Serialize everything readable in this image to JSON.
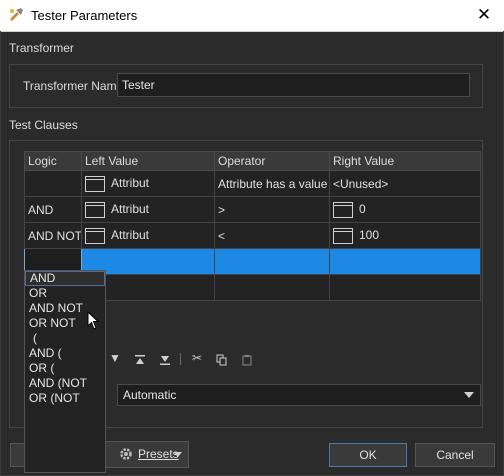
{
  "window": {
    "title": "Tester Parameters",
    "close_glyph": "✕"
  },
  "sections": {
    "transformer": "Transformer",
    "test_clauses": "Test Clauses"
  },
  "transformer_name": {
    "label": "Transformer Name:",
    "value": "Tester"
  },
  "grid": {
    "headers": [
      "Logic",
      "Left Value",
      "Operator",
      "Right Value"
    ],
    "rows": [
      {
        "logic": "",
        "left": "Attribut",
        "operator": "Attribute has a value",
        "right": "<Unused>"
      },
      {
        "logic": "AND",
        "left": "Attribut",
        "operator": ">",
        "right": "0"
      },
      {
        "logic": "AND NOT",
        "left": "Attribut",
        "operator": "<",
        "right": "100"
      }
    ]
  },
  "logic_dropdown": {
    "options": [
      "AND",
      "OR",
      "AND NOT",
      "OR NOT",
      "(",
      "AND (",
      "OR (",
      "AND (NOT",
      "OR (NOT"
    ],
    "highlighted": "AND"
  },
  "toolbar": {
    "icons": [
      "move-down-icon",
      "move-top-icon",
      "move-bottom-icon",
      "cut-icon",
      "copy-icon",
      "paste-icon"
    ]
  },
  "combo": {
    "value": "Automatic"
  },
  "buttons": {
    "presets": "Presets",
    "ok": "OK",
    "cancel": "Cancel"
  },
  "colors": {
    "selection": "#1e88e5",
    "background": "#2b2b2b"
  }
}
